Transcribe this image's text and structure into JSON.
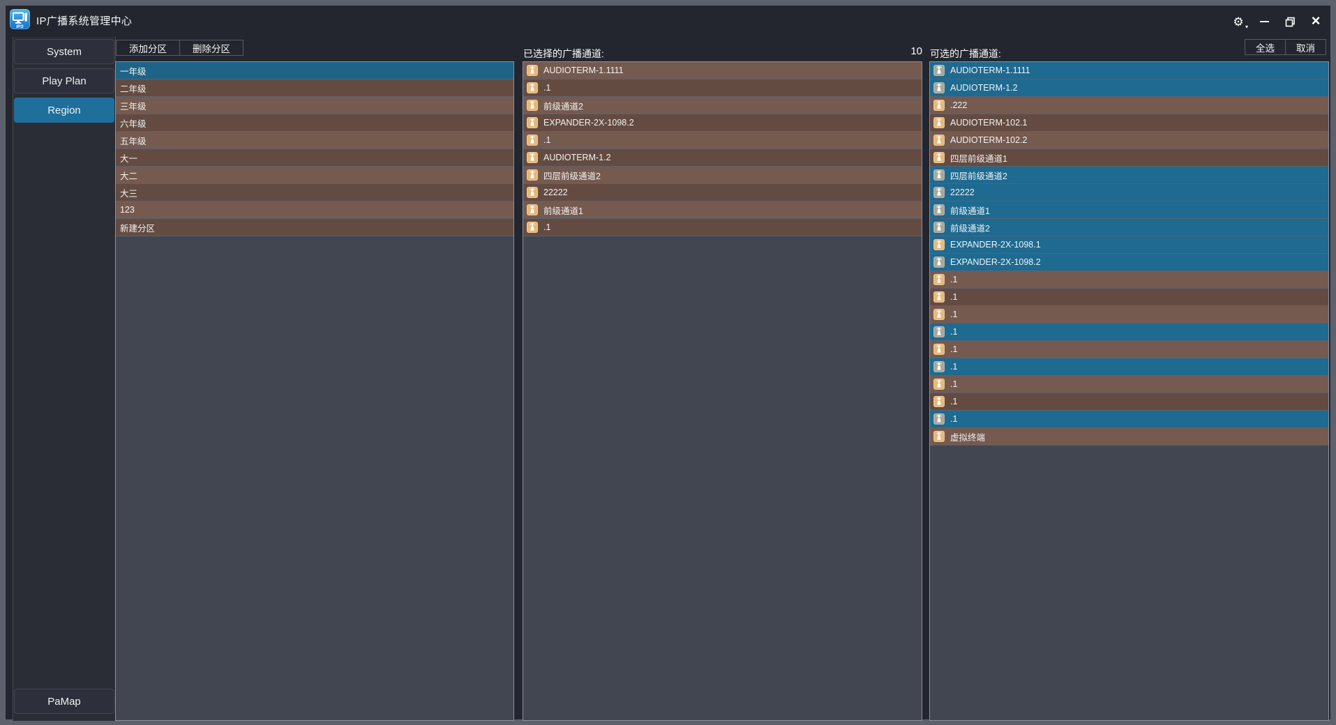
{
  "window": {
    "title": "IP广播系统管理中心"
  },
  "sidebar": {
    "items": [
      {
        "label": "System",
        "active": false
      },
      {
        "label": "Play Plan",
        "active": false
      },
      {
        "label": "Region",
        "active": true
      }
    ],
    "bottom_item": {
      "label": "PaMap"
    }
  },
  "left_panel": {
    "toolbar": {
      "add_label": "添加分区",
      "delete_label": "删除分区"
    },
    "regions": [
      {
        "name": "一年级",
        "bg": "sel"
      },
      {
        "name": "二年级",
        "bg": "d"
      },
      {
        "name": "三年级",
        "bg": "l"
      },
      {
        "name": "六年级",
        "bg": "d"
      },
      {
        "name": "五年级",
        "bg": "l"
      },
      {
        "name": "大一",
        "bg": "d"
      },
      {
        "name": "大二",
        "bg": "l"
      },
      {
        "name": "大三",
        "bg": "d"
      },
      {
        "name": "123",
        "bg": "l"
      },
      {
        "name": "新建分区",
        "bg": "d"
      }
    ]
  },
  "middle_panel": {
    "header": "已选择的广播通道:",
    "count": "10",
    "channels": [
      {
        "name": "AUDIOTERM-1.1111",
        "bg": "l",
        "icon": "gold"
      },
      {
        "name": ".1",
        "bg": "d",
        "icon": "gold"
      },
      {
        "name": "前级通道2",
        "bg": "l",
        "icon": "gold"
      },
      {
        "name": "EXPANDER-2X-1098.2",
        "bg": "d",
        "icon": "gold"
      },
      {
        "name": ".1",
        "bg": "l",
        "icon": "gold"
      },
      {
        "name": "AUDIOTERM-1.2",
        "bg": "d",
        "icon": "gold"
      },
      {
        "name": "四层前级通道2",
        "bg": "l",
        "icon": "gold"
      },
      {
        "name": "22222",
        "bg": "d",
        "icon": "gold"
      },
      {
        "name": "前级通道1",
        "bg": "l",
        "icon": "gold"
      },
      {
        "name": ".1",
        "bg": "d",
        "icon": "gold"
      }
    ]
  },
  "right_panel": {
    "header": "可选的广播通道:",
    "select_all_label": "全选",
    "cancel_label": "取消",
    "channels": [
      {
        "name": "AUDIOTERM-1.1111",
        "bg": "sel",
        "icon": "gray"
      },
      {
        "name": "AUDIOTERM-1.2",
        "bg": "sel",
        "icon": "gray"
      },
      {
        "name": ".222",
        "bg": "l",
        "icon": "gold"
      },
      {
        "name": "AUDIOTERM-102.1",
        "bg": "d",
        "icon": "gold"
      },
      {
        "name": "AUDIOTERM-102.2",
        "bg": "l",
        "icon": "gold"
      },
      {
        "name": "四层前级通道1",
        "bg": "d",
        "icon": "gold"
      },
      {
        "name": "四层前级通道2",
        "bg": "sel",
        "icon": "gray"
      },
      {
        "name": "22222",
        "bg": "sel",
        "icon": "gray"
      },
      {
        "name": "前级通道1",
        "bg": "sel",
        "icon": "gray"
      },
      {
        "name": "前级通道2",
        "bg": "sel",
        "icon": "gray"
      },
      {
        "name": "EXPANDER-2X-1098.1",
        "bg": "sel",
        "icon": "gold"
      },
      {
        "name": "EXPANDER-2X-1098.2",
        "bg": "sel",
        "icon": "gray"
      },
      {
        "name": ".1",
        "bg": "l",
        "icon": "gold"
      },
      {
        "name": ".1",
        "bg": "d",
        "icon": "gold"
      },
      {
        "name": ".1",
        "bg": "l",
        "icon": "gold"
      },
      {
        "name": ".1",
        "bg": "sel",
        "icon": "gray"
      },
      {
        "name": ".1",
        "bg": "l",
        "icon": "gold"
      },
      {
        "name": ".1",
        "bg": "sel",
        "icon": "gray"
      },
      {
        "name": ".1",
        "bg": "l",
        "icon": "gold"
      },
      {
        "name": ".1",
        "bg": "d",
        "icon": "gold"
      },
      {
        "name": ".1",
        "bg": "sel",
        "icon": "gray"
      },
      {
        "name": "虚拟终端",
        "bg": "l",
        "icon": "gold"
      }
    ]
  },
  "colors": {
    "active_nav_teal": "#1e6f9c",
    "selected_row_teal_left": "#1e6487",
    "selected_row_teal_right": "#1e6a90",
    "row_brown_light": "#755a4f",
    "row_brown_dark": "#644b41",
    "icon_gold": "#e6b878",
    "icon_gray": "#a8a79a",
    "panel_bg": "#424651",
    "window_frame": "#5c616b"
  }
}
